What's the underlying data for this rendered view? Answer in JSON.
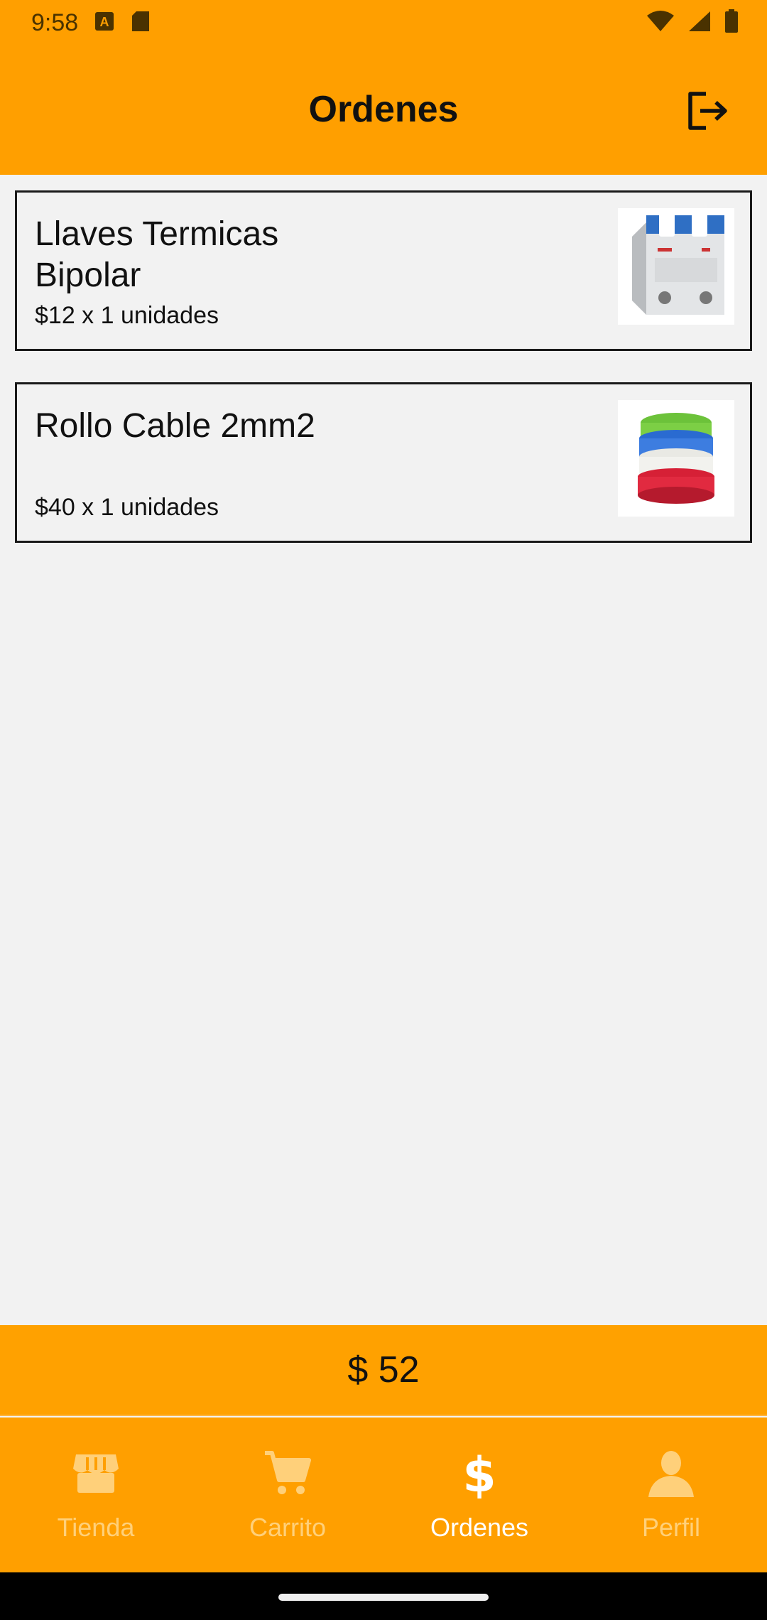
{
  "status_bar": {
    "time": "9:58",
    "icons": [
      "font-a-icon",
      "sd-card-icon",
      "wifi-icon",
      "signal-icon",
      "battery-icon"
    ]
  },
  "app_bar": {
    "title": "Ordenes",
    "action_icon": "logout-icon"
  },
  "orders": [
    {
      "name": "Llaves Termicas Bipolar",
      "quantity_text": "$12 x 1 unidades",
      "image": "circuit-breaker-image"
    },
    {
      "name": "Rollo Cable 2mm2",
      "quantity_text": "$40 x 1 unidades",
      "image": "cable-roll-image"
    }
  ],
  "total": {
    "text": "$ 52"
  },
  "bottom_nav": {
    "items": [
      {
        "label": "Tienda",
        "icon": "store-icon",
        "active": false
      },
      {
        "label": "Carrito",
        "icon": "cart-icon",
        "active": false
      },
      {
        "label": "Ordenes",
        "icon": "dollar-icon",
        "active": true
      },
      {
        "label": "Perfil",
        "icon": "person-icon",
        "active": false
      }
    ]
  },
  "colors": {
    "primary": "#ff9f00",
    "background": "#f2f2f2",
    "nav_inactive": "#ffd07a",
    "nav_active": "#ffffff"
  }
}
